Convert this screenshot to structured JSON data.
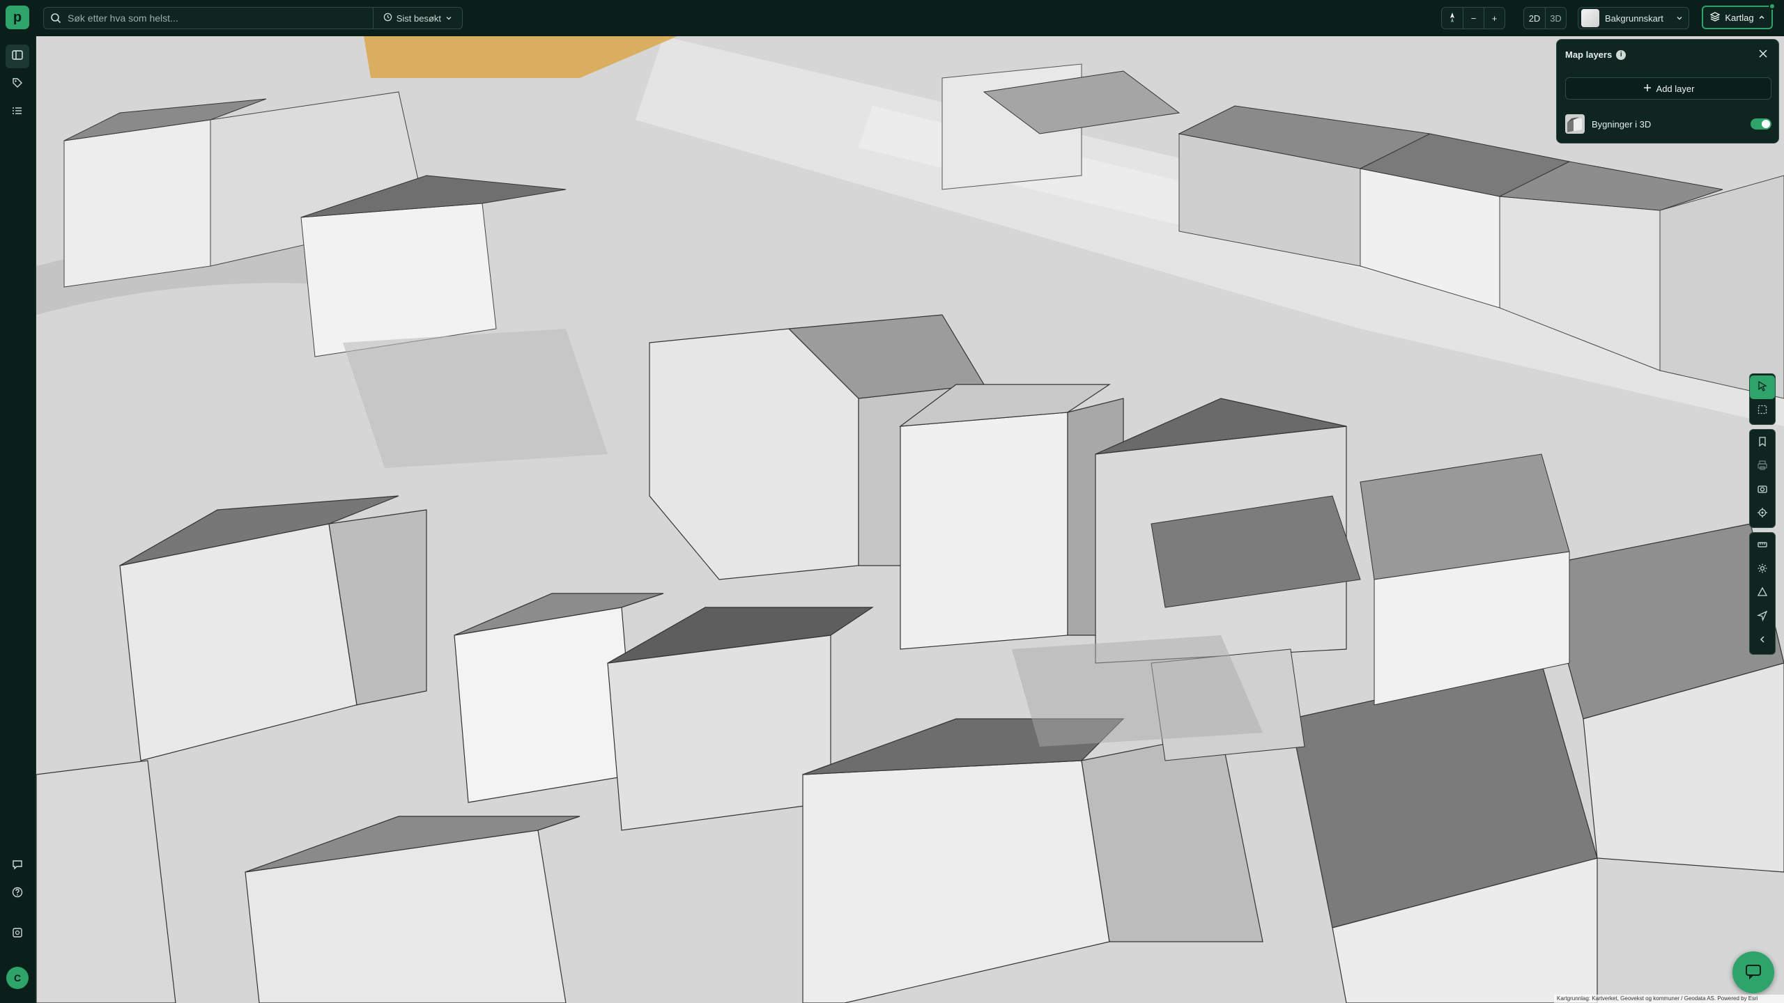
{
  "topbar": {
    "logo_text": "p",
    "search_placeholder": "Søk etter hva som helst...",
    "recent_label": "Sist besøkt",
    "zoom_out": "−",
    "zoom_in": "+",
    "mode_2d": "2D",
    "mode_3d": "3D",
    "basemap_label": "Bakgrunnskart",
    "layers_label": "Kartlag"
  },
  "layers_panel": {
    "title": "Map layers",
    "add_layer_label": "Add layer",
    "layers": [
      {
        "name": "Bygninger i 3D",
        "enabled": true
      }
    ]
  },
  "user": {
    "initial": "C"
  },
  "map": {
    "attribution": "Kartgrunnlag: Kartverket, Geovekst og kommuner / Geodata AS. Powered by Esri"
  },
  "colors": {
    "accent": "#2ea36a",
    "chrome": "#0a1e1a",
    "map_ground": "#d7d7d7"
  },
  "icons": {
    "sidebar": [
      "map-icon",
      "tag-icon",
      "list-icon",
      "comment-icon",
      "help-icon",
      "plugin-icon"
    ],
    "right_toolbar": [
      "cursor-icon",
      "select-area-icon",
      "bookmark-icon",
      "print-icon",
      "camera-icon",
      "locate-icon",
      "measure-icon",
      "settings-icon",
      "shape-icon",
      "navigate-icon",
      "collapse-icon"
    ]
  }
}
